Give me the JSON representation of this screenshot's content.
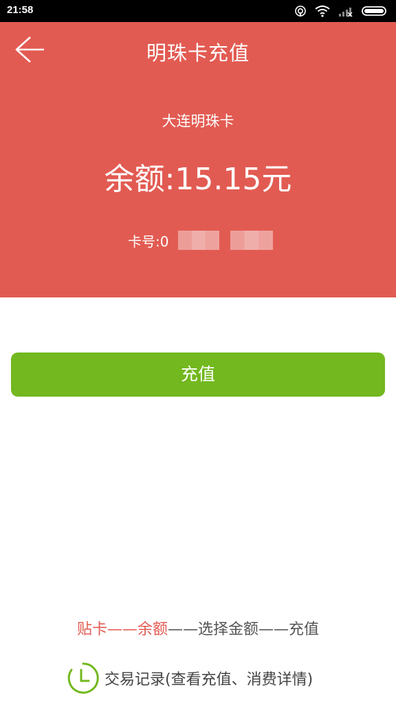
{
  "status_bar": {
    "time": "21:58"
  },
  "header": {
    "title": "明珠卡充值",
    "back_icon": "back-arrow-icon",
    "card_name": "大连明珠卡",
    "balance": "余额:15.15元",
    "card_number_label": "卡号:0"
  },
  "actions": {
    "recharge_label": "充值"
  },
  "footer": {
    "step_active": "贴卡——余额",
    "step_rest": "——选择金额——充值",
    "transaction_link": "交易记录(查看充值、消费详情)",
    "transaction_icon": "clock-icon"
  },
  "colors": {
    "header_bg": "#e25b52",
    "button_bg": "#72b81e",
    "accent_red": "#e25b52",
    "icon_green": "#72b81e"
  }
}
